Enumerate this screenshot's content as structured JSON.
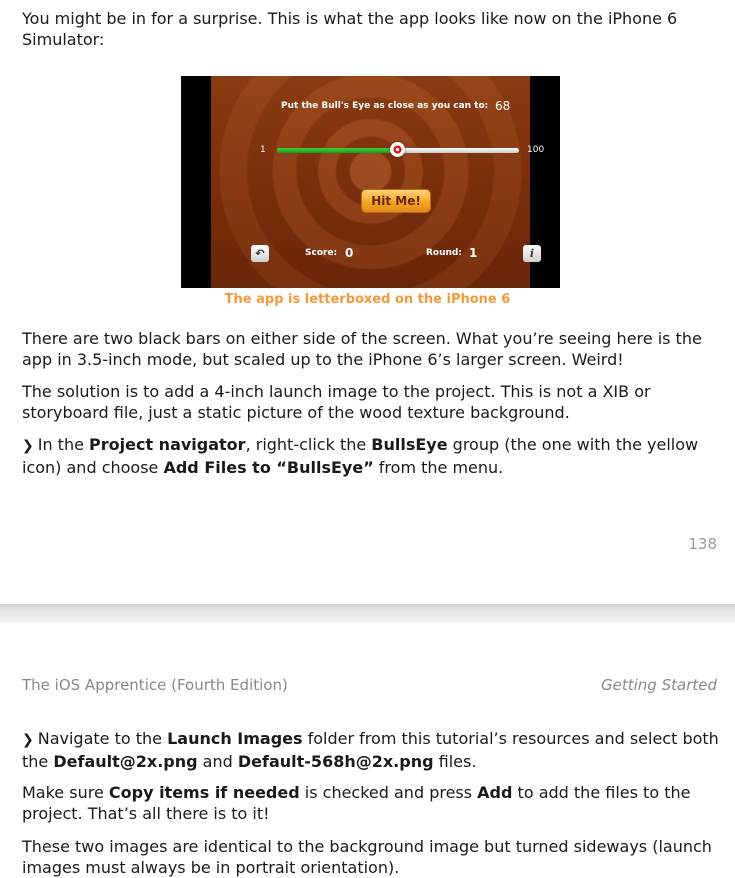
{
  "page1": {
    "intro": "You might be in for a surprise. This is what the app looks like now on the iPhone 6 Simulator:",
    "screenshot": {
      "prompt": "Put the Bull's Eye as close as you can to:",
      "target": "68",
      "slider_min": "1",
      "slider_max": "100",
      "slider_value_fraction": 0.5,
      "hit_button": "Hit Me!",
      "score_label": "Score:",
      "score_value": "0",
      "round_label": "Round:",
      "round_value": "1",
      "start_over_icon": "undo-arrow-icon",
      "info_icon": "info-icon"
    },
    "caption": "The app is letterboxed on the iPhone 6",
    "p1": "There are two black bars on either side of the screen. What you’re seeing here is the app in 3.5-inch mode, but scaled up to the iPhone 6’s larger screen. Weird!",
    "p2": "The solution is to add a 4-inch launch image to the project. This is not a XIB or storyboard file, just a static picture of the wood texture background.",
    "p3": {
      "a": "In the ",
      "b1": "Project navigator",
      "c": ", right-click the ",
      "b2": "BullsEye",
      "d": " group (the one with the yellow icon) and choose ",
      "b3": "Add Files to “BullsEye”",
      "e": " from the menu."
    },
    "page_number": "138"
  },
  "page2": {
    "header_left": "The iOS Apprentice (Fourth Edition)",
    "header_right": "Getting Started",
    "p1": {
      "a": "Navigate to the ",
      "b1": "Launch Images",
      "c": " folder from this tutorial’s resources and select both the ",
      "b2": "Default@2x.png",
      "d": " and ",
      "b3": "Default-568h@2x.png",
      "e": " files."
    },
    "p2": {
      "a": "Make sure ",
      "b1": "Copy items if needed",
      "c": " is checked and press ",
      "b2": "Add",
      "d": " to add the files to the project. That’s all there is to it!"
    },
    "p3": "These two images are identical to the background image but turned sideways (launch images must always be in portrait orientation)."
  }
}
